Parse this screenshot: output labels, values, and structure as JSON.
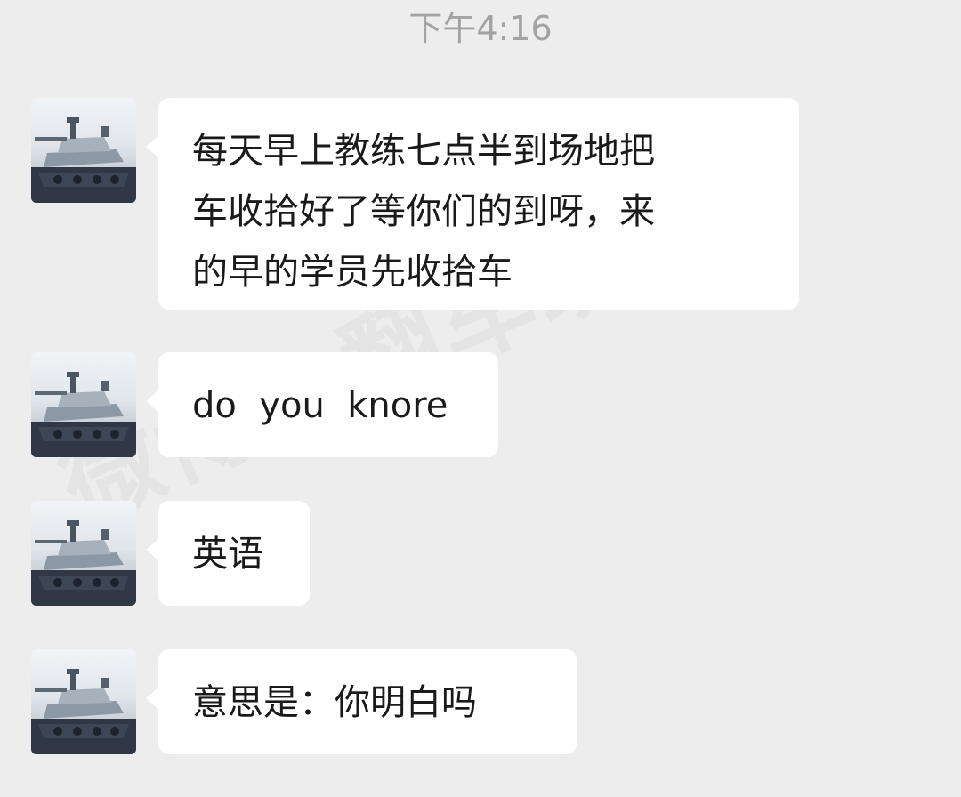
{
  "chat": {
    "timestamp": "下午4:16",
    "messages": [
      {
        "text": "每天早上教练七点半到场地把\n车收拾好了等你们的到呀，来\n的早的学员先收拾车",
        "avatar": "tank-avatar"
      },
      {
        "text": "do  you  knore",
        "avatar": "tank-avatar"
      },
      {
        "text": "英语",
        "avatar": "tank-avatar"
      },
      {
        "text": "意思是：你明白吗",
        "avatar": "tank-avatar"
      }
    ]
  },
  "watermark": {
    "text": "微博@翻车现场"
  }
}
